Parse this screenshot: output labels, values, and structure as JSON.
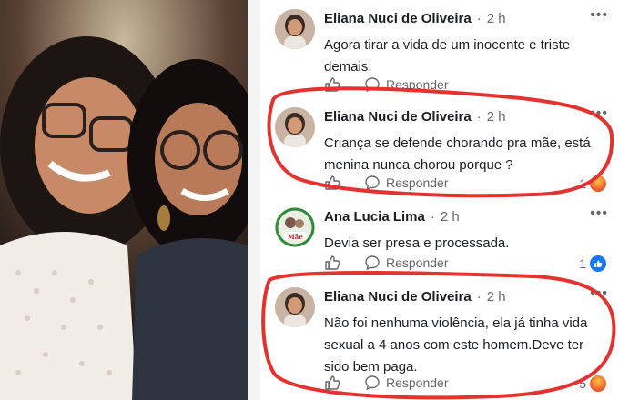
{
  "comments": [
    {
      "author": "Eliana Nuci de Oliveira",
      "time": "2 h",
      "text": "Agora tirar a vida de um inocente e triste demais.",
      "reply_label": "Responder",
      "reaction_count": ""
    },
    {
      "author": "Eliana Nuci de Oliveira",
      "time": "2 h",
      "text": "Criança se defende chorando pra mãe, está menina nunca chorou porque ?",
      "reply_label": "Responder",
      "reaction_count": "1"
    },
    {
      "author": "Ana Lucia Lima",
      "time": "2 h",
      "text": "Devia ser presa e processada.",
      "reply_label": "Responder",
      "reaction_count": "1",
      "avatar_label": "Mãe"
    },
    {
      "author": "Eliana Nuci de Oliveira",
      "time": "2 h",
      "text": "Não foi nenhuma violência, ela já tinha vida sexual a 4 anos com este homem.Deve ter sido bem paga.",
      "reply_label": "Responder",
      "reaction_count": "5"
    }
  ],
  "more_glyph": "•••",
  "separator": "·",
  "colors": {
    "highlight": "#e5322f",
    "like": "#1877f2",
    "secondary_text": "#65676b"
  }
}
